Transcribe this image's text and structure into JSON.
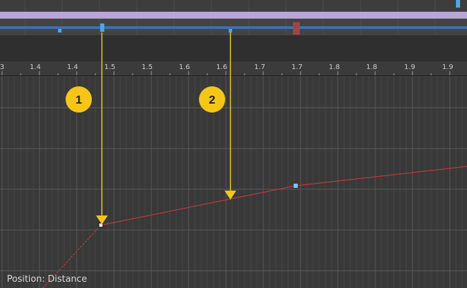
{
  "ruler": {
    "labels": [
      "3",
      "1.4",
      "1.4",
      "1.5",
      "1.5",
      "1.6",
      "1.6",
      "1.7",
      "1.7",
      "1.8",
      "1.8",
      "1.9",
      "1.9"
    ]
  },
  "callouts": [
    {
      "number": "1"
    },
    {
      "number": "2"
    }
  ],
  "status": {
    "text": "Position: Distance"
  },
  "colors": {
    "curve": "#c0393b",
    "callout": "#f5c518",
    "track_line": "#3f6fb0",
    "lavender": "#b8a6d6",
    "keyframe": "#4aa8e8",
    "marker_red": "#a34444"
  },
  "icons": {
    "arrow": "down-arrow-icon",
    "keyframe": "keyframe-icon"
  }
}
